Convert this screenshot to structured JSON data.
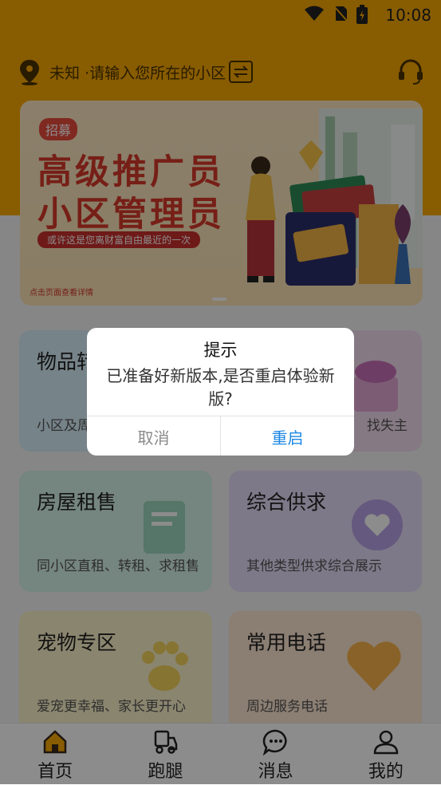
{
  "status": {
    "time": "10:08"
  },
  "location": {
    "city": "未知",
    "prompt": "·请输入您所在的小区"
  },
  "banner": {
    "tag": "招募",
    "title_line1": "高级推广员",
    "title_line2": "小区管理员",
    "slogan": "或许这是您离财富自由最近的一次",
    "hint": "点击页面查看详情"
  },
  "cards": {
    "lost": {
      "title": "物品转",
      "desc": "小区及周"
    },
    "found": {
      "desc": "找失主"
    },
    "house": {
      "title": "房屋租售",
      "desc": "同小区直租、转租、求租售"
    },
    "supply": {
      "title": "综合供求",
      "desc": "其他类型供求综合展示"
    },
    "pet": {
      "title": "宠物专区",
      "desc": "爱宠更幸福、家长更开心"
    },
    "phone": {
      "title": "常用电话",
      "desc": "周边服务电话"
    }
  },
  "tabs": [
    {
      "label": "首页",
      "icon": "home-icon"
    },
    {
      "label": "跑腿",
      "icon": "delivery-icon"
    },
    {
      "label": "消息",
      "icon": "message-icon"
    },
    {
      "label": "我的",
      "icon": "user-icon"
    }
  ],
  "dialog": {
    "title": "提示",
    "message": "已准备好新版本,是否重启体验新版?",
    "cancel": "取消",
    "confirm": "重启"
  },
  "colors": {
    "primary": "#f7a800",
    "link": "#1e88e5"
  }
}
